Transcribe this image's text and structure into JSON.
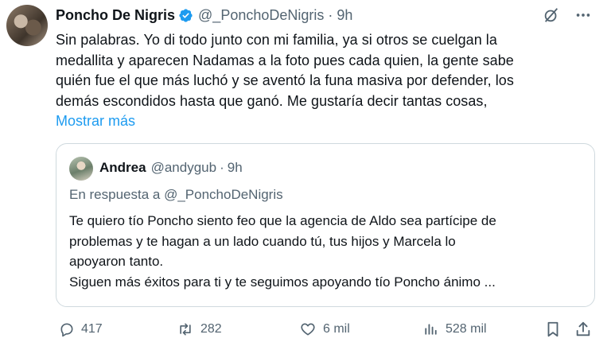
{
  "tweet": {
    "author_name": "Poncho De Nigris",
    "author_handle": "@_PonchoDeNigris",
    "separator": "·",
    "time": "9h",
    "text_lines": [
      "Sin palabras. Yo di todo junto con mi familia, ya si otros se cuelgan la",
      "medallita y aparecen Nadamas a la foto pues cada quien, la gente sabe",
      "quién fue el que más luchó y se aventó la funa masiva por defender, los",
      "demás escondidos hasta que ganó. Me gustaría decir tantas cosas,"
    ],
    "show_more": "Mostrar más"
  },
  "quote": {
    "author_name": "Andrea",
    "author_handle": "@andygub",
    "separator": "·",
    "time": "9h",
    "reply_to": "En respuesta a @_PonchoDeNigris",
    "text_lines": [
      "Te quiero tío Poncho siento feo que la agencia de Aldo sea partícipe de",
      "problemas y te hagan a un lado cuando tú, tus hijos y Marcela lo",
      "apoyaron tanto.",
      "Siguen más éxitos para ti y te seguimos apoyando tío Poncho ánimo ..."
    ]
  },
  "actions": {
    "replies": "417",
    "retweets": "282",
    "likes": "6 mil",
    "views": "528 mil"
  },
  "icons": {
    "verified": "verified-badge-icon",
    "grok": "grok-icon",
    "more": "more-options-icon",
    "reply": "reply-icon",
    "retweet": "retweet-icon",
    "like": "heart-icon",
    "views": "views-icon",
    "bookmark": "bookmark-icon",
    "share": "share-icon"
  },
  "colors": {
    "accent": "#1d9bf0",
    "text": "#0f1419",
    "secondary": "#536471",
    "border": "#cfd9de"
  }
}
